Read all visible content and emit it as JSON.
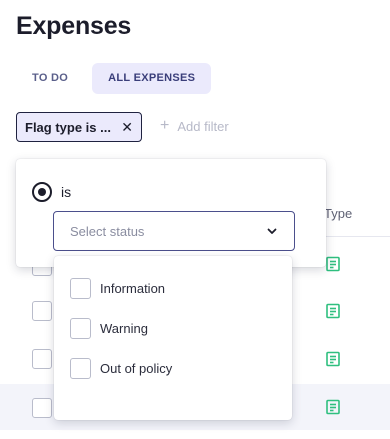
{
  "page": {
    "title": "Expenses"
  },
  "tabs": [
    {
      "label": "TO DO",
      "active": false
    },
    {
      "label": "ALL EXPENSES",
      "active": true
    }
  ],
  "filter_chip": {
    "label": "Flag type  is ...",
    "close_glyph": "✕"
  },
  "add_filter": {
    "plus_glyph": "+",
    "label": "Add filter"
  },
  "table": {
    "columns": [
      "Type"
    ],
    "rows": [
      {
        "type_icon": "receipt-icon",
        "hovered": false
      },
      {
        "type_icon": "receipt-icon",
        "hovered": false
      },
      {
        "type_icon": "receipt-icon",
        "hovered": false
      },
      {
        "type_icon": "receipt-icon",
        "hovered": true
      }
    ]
  },
  "filter_popover": {
    "operator": {
      "label": "is",
      "selected": true
    },
    "status_select": {
      "placeholder": "Select status",
      "value": ""
    }
  },
  "status_options": [
    {
      "label": "Information",
      "checked": false
    },
    {
      "label": "Warning",
      "checked": false
    },
    {
      "label": "Out of policy",
      "checked": false
    }
  ],
  "colors": {
    "accent": "#3a3e7a",
    "chip_background": "#ebeafc",
    "receipt_icon": "#2fbf7f",
    "row_hover": "#f3f4fa"
  }
}
